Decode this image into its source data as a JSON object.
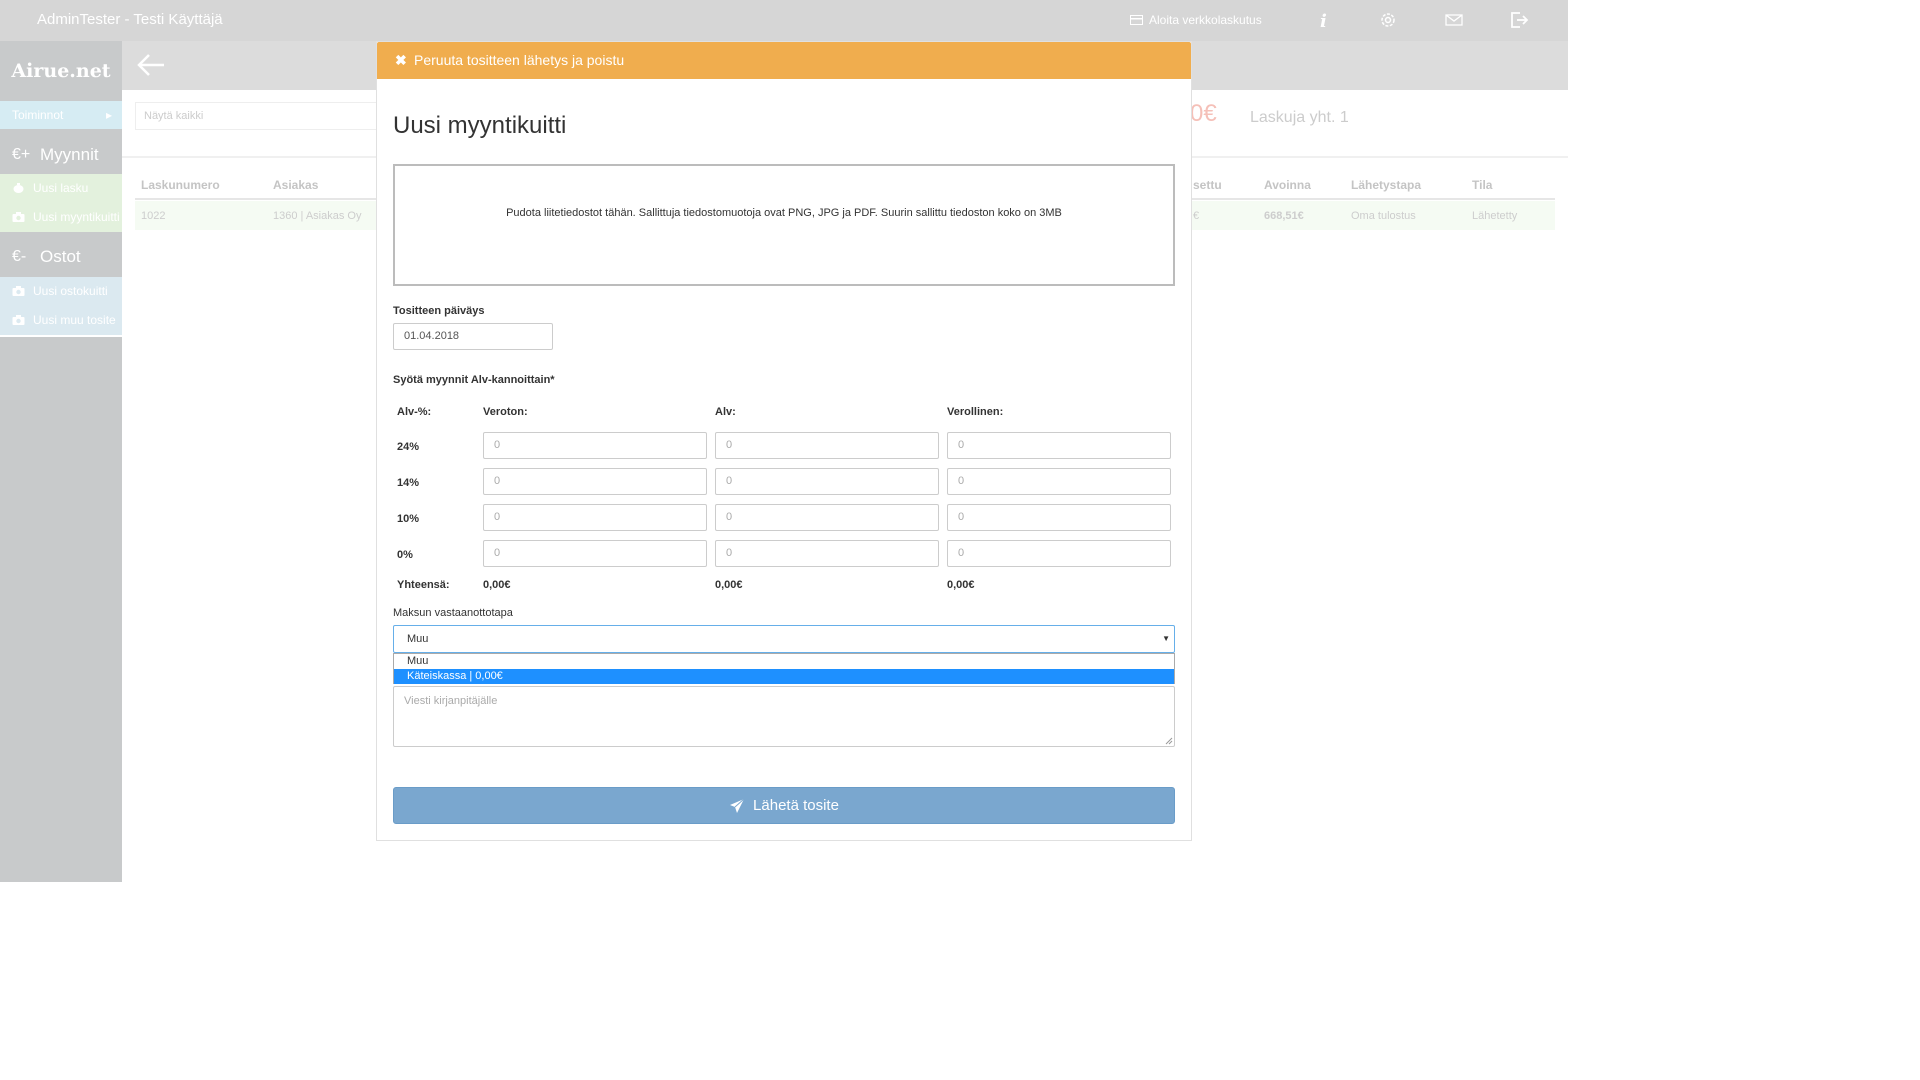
{
  "topbar": {
    "user": "AdminTester - Testi Käyttäjä",
    "start_einvoicing": "Aloita verkkolaskutus",
    "icons": [
      "card-icon",
      "info-icon",
      "gear-icon",
      "mail-icon",
      "logout-icon"
    ]
  },
  "sidebar": {
    "logo": "Airue.net",
    "actions_label": "Toiminnot",
    "sales": {
      "symbol": "€+",
      "label": "Myynnit",
      "items": [
        "Uusi lasku",
        "Uusi myyntikuitti"
      ]
    },
    "purchases": {
      "symbol": "€-",
      "label": "Ostot",
      "items": [
        "Uusi ostokuitti",
        "Uusi muu tosite"
      ]
    }
  },
  "background": {
    "search_placeholder": "Näytä kaikki",
    "sum_partial": "0€",
    "invoice_count": "Laskuja yht. 1",
    "columns": {
      "number": "Laskunumero",
      "customer": "Asiakas",
      "paid_partial": "settu",
      "open": "Avoinna",
      "delivery": "Lähetystapa",
      "status": "Tila"
    },
    "row": {
      "number": "1022",
      "customer": "1360 | Asiakas Oy",
      "paid_partial": "€",
      "open": "668,51€",
      "delivery": "Oma tulostus",
      "status": "Lähetetty"
    }
  },
  "modal": {
    "cancel_bar": "Peruuta tositteen lähetys ja poistu",
    "title": "Uusi myyntikuitti",
    "dropzone_text": "Pudota liitetiedostot tähän. Sallittuja tiedostomuotoja ovat PNG, JPG ja PDF. Suurin sallittu tiedoston koko on 3MB",
    "date_label": "Tositteen päiväys",
    "date_value": "01.04.2018",
    "vat_section_label": "Syötä myynnit Alv-kannoittain*",
    "headers": {
      "rate": "Alv-%:",
      "net": "Veroton:",
      "vat": "Alv:",
      "gross": "Verollinen:"
    },
    "rows": [
      {
        "rate": "24%",
        "net": "0",
        "vat": "0",
        "gross": "0"
      },
      {
        "rate": "14%",
        "net": "0",
        "vat": "0",
        "gross": "0"
      },
      {
        "rate": "10%",
        "net": "0",
        "vat": "0",
        "gross": "0"
      },
      {
        "rate": "0%",
        "net": "0",
        "vat": "0",
        "gross": "0"
      }
    ],
    "totals": {
      "label": "Yhteensä:",
      "net": "0,00€",
      "vat": "0,00€",
      "gross": "0,00€"
    },
    "payment_label": "Maksun vastaanottotapa",
    "payment_selected": "Muu",
    "payment_options": [
      "Muu",
      "Käteiskassa | 0,00€"
    ],
    "message_placeholder": "Viesti kirjanpitäjälle",
    "send_button": "Lähetä tosite"
  }
}
